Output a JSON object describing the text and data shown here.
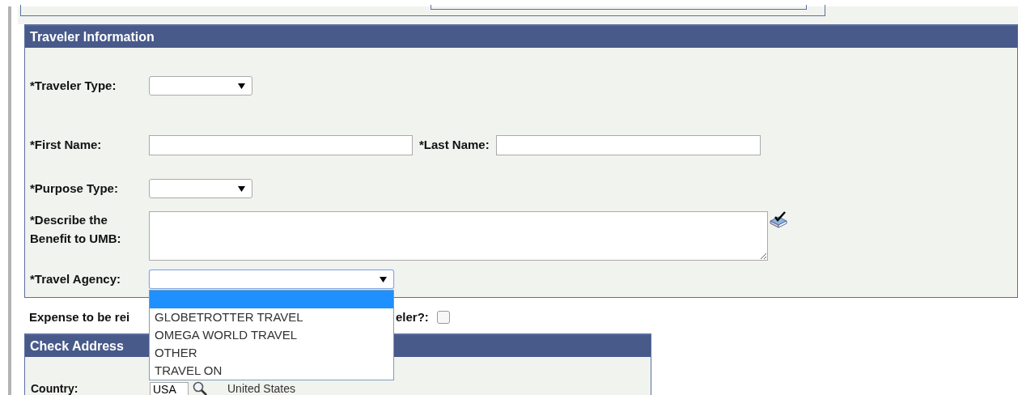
{
  "traveler_information": {
    "title": "Traveler Information",
    "rows": [
      {
        "fields": [
          {
            "kind": "select",
            "label": "*Traveler Type:"
          }
        ]
      },
      {
        "fields": [
          {
            "kind": "text",
            "label": "*First Name:"
          },
          {
            "kind": "text",
            "label": "*Last Name:"
          }
        ]
      },
      {
        "fields": [
          {
            "kind": "select",
            "label": "*Purpose Type:"
          }
        ]
      },
      {
        "fields": [
          {
            "kind": "textarea",
            "label": "*Describe the Benefit to UMB:",
            "spell_check": true
          }
        ]
      },
      {
        "fields": [
          {
            "kind": "select",
            "label": "*Travel Agency:",
            "focused": true,
            "expanded": true,
            "options": [
              {
                "selected": true
              },
              {
                "label": "GLOBETROTTER TRAVEL",
                "selected": false
              },
              {
                "label": "OMEGA WORLD TRAVEL",
                "selected": false
              },
              {
                "label": "OTHER",
                "selected": false
              },
              {
                "label": "TRAVEL ON",
                "selected": false
              }
            ]
          }
        ]
      }
    ]
  },
  "reimbursement": {
    "label_parts": [
      "Expense to be rei",
      "eler?:"
    ],
    "checked": false
  },
  "check_address": {
    "title": "Check Address",
    "country_label": "Country:",
    "country_code": "USA",
    "country_name": "United States"
  }
}
